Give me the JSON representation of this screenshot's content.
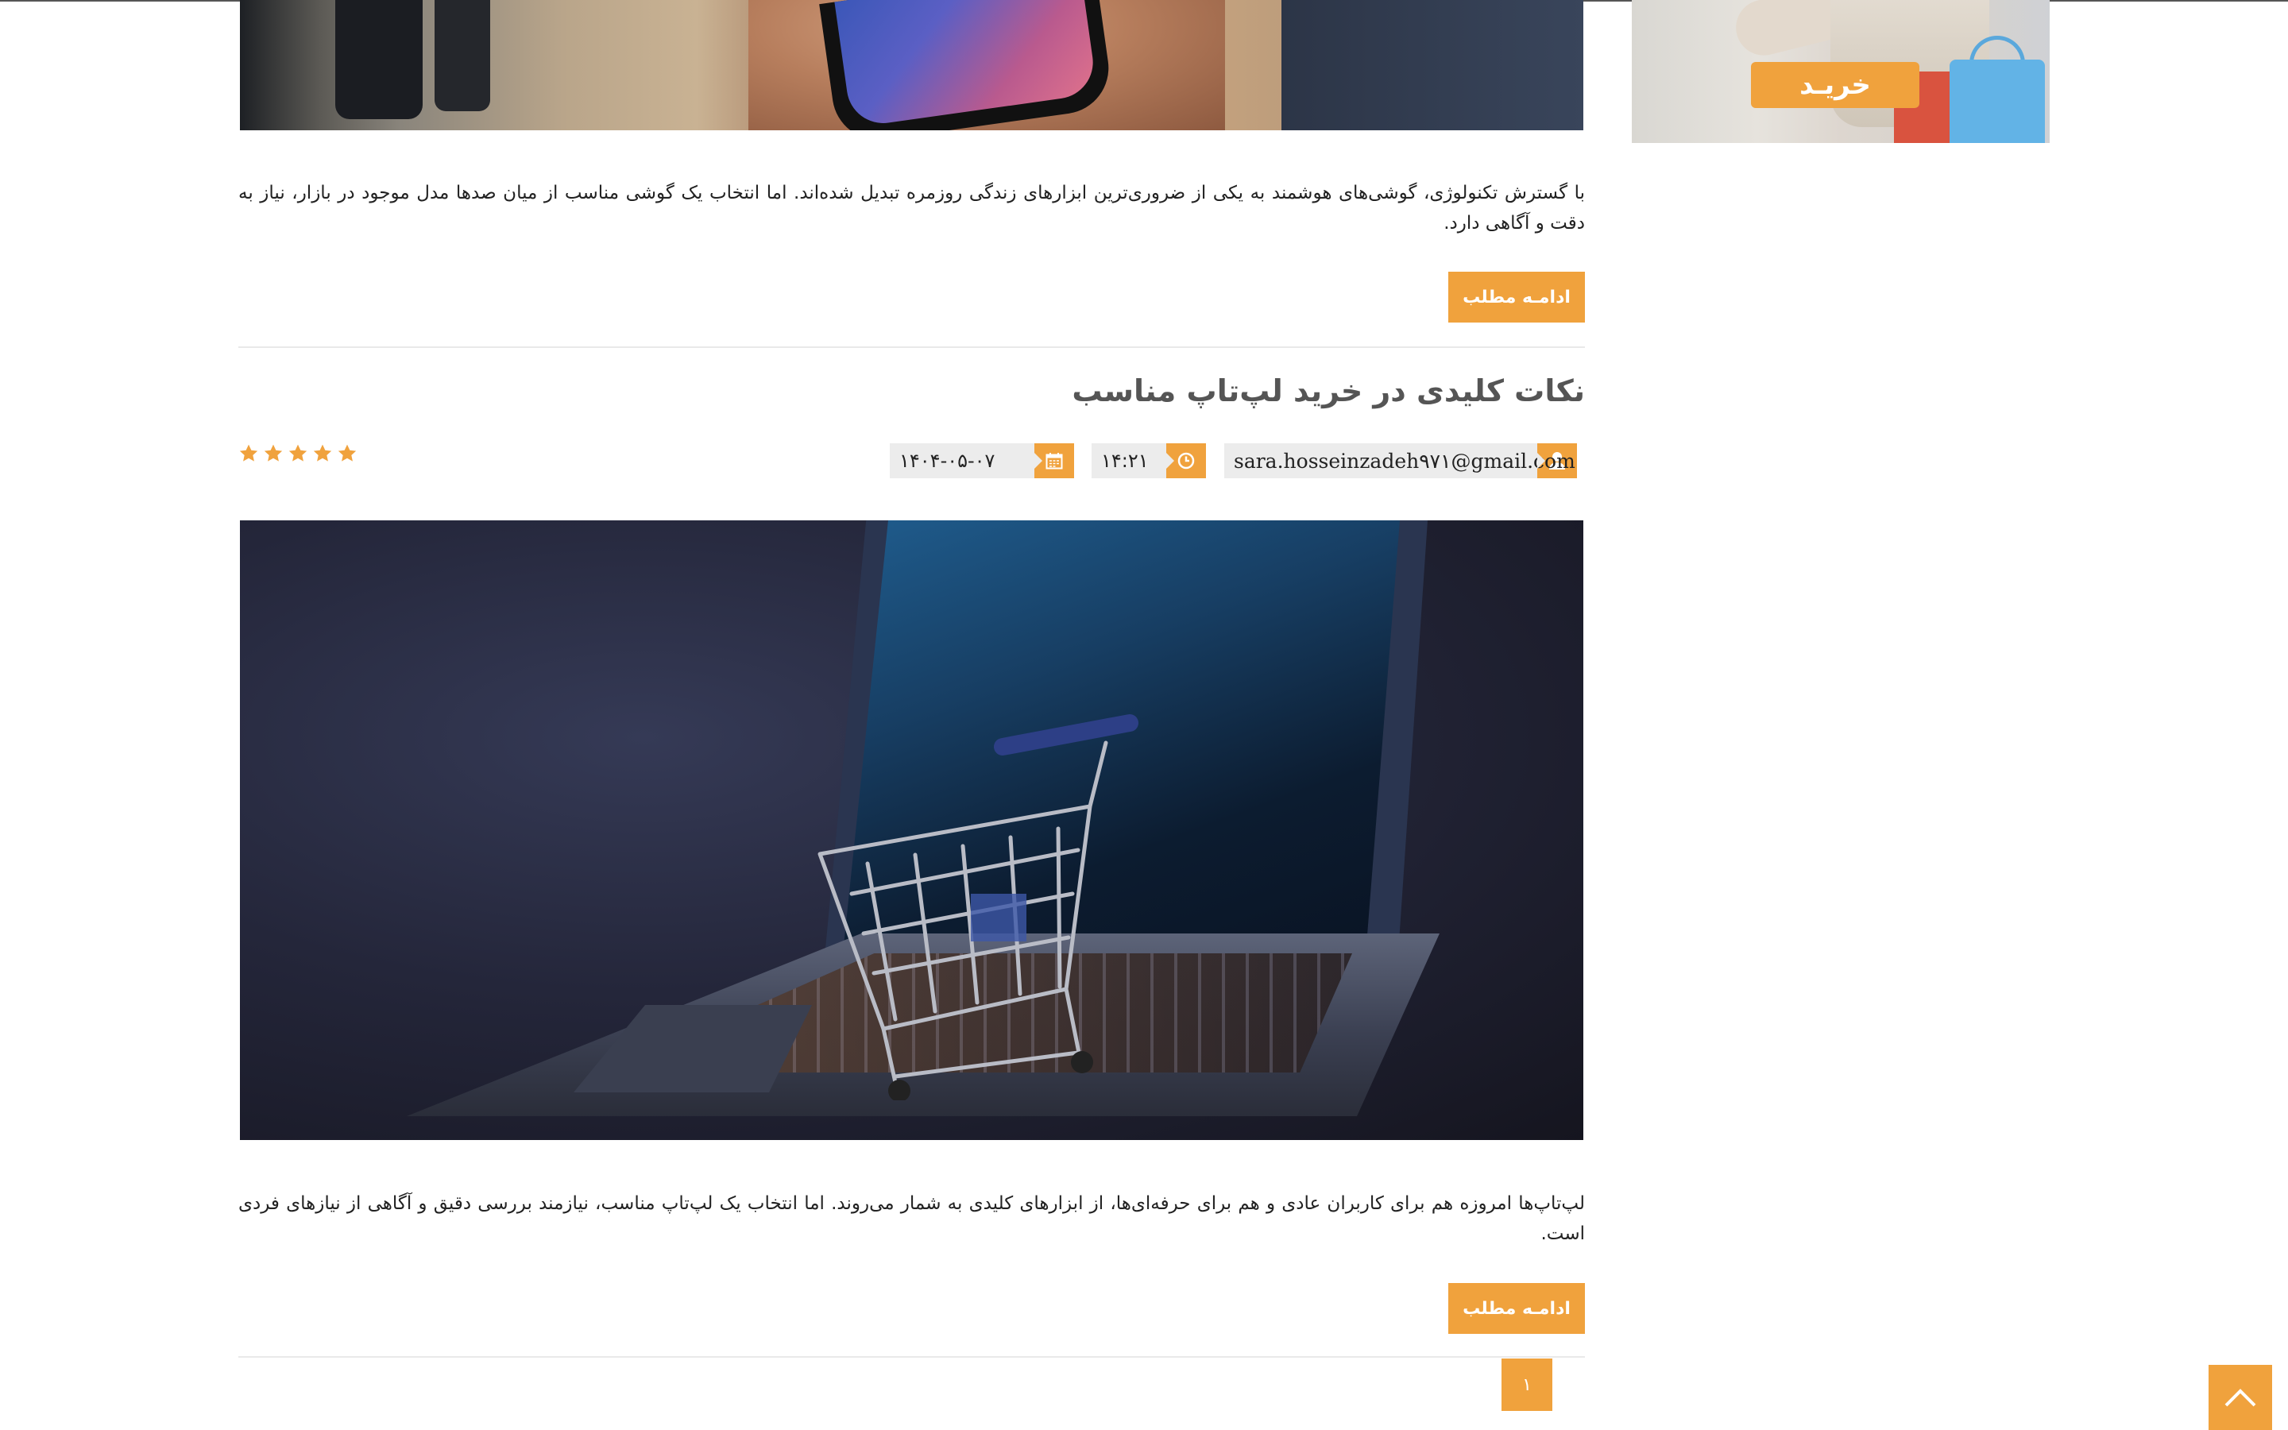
{
  "posts": [
    {
      "excerpt": "با گسترش تکنولوژی، گوشی‌های هوشمند به یکی از ضروری‌ترین ابزارهای زندگی روزمره تبدیل شده‌اند. اما انتخاب یک گوشی مناسب از میان صدها مدل موجود در بازار، نیاز به دقت و آگاهی دارد.",
      "more_label": "ادامـه مطلب"
    },
    {
      "title": "نکات کلیدی در خرید لپ‌تاپ مناسب",
      "author": "sara.hosseinzadeh۹۷۱@gmail.com",
      "time": "۱۴:۲۱",
      "date": "۱۴۰۴-۰۵-۰۷",
      "rating": 5,
      "rating_max": 5,
      "excerpt": "لپ‌تاپ‌ها امروزه هم برای کاربران عادی و هم برای حرفه‌ای‌ها، از ابزارهای کلیدی به شمار می‌روند. اما انتخاب یک لپ‌تاپ مناسب، نیازمند بررسی دقیق و آگاهی از نیازهای فردی است.",
      "more_label": "ادامـه مطلب"
    }
  ],
  "pagination": {
    "current_page": "۱"
  },
  "sidebar": {
    "banner_button": "خریـد"
  },
  "icons": {
    "author": "user-icon",
    "time": "clock-icon",
    "date": "calendar-icon",
    "rating": "star-icon",
    "back_to_top": "chevron-up-icon"
  },
  "colors": {
    "accent": "#f0a23d",
    "meta_bg": "#ececec",
    "title": "#555555",
    "text": "#222222"
  }
}
